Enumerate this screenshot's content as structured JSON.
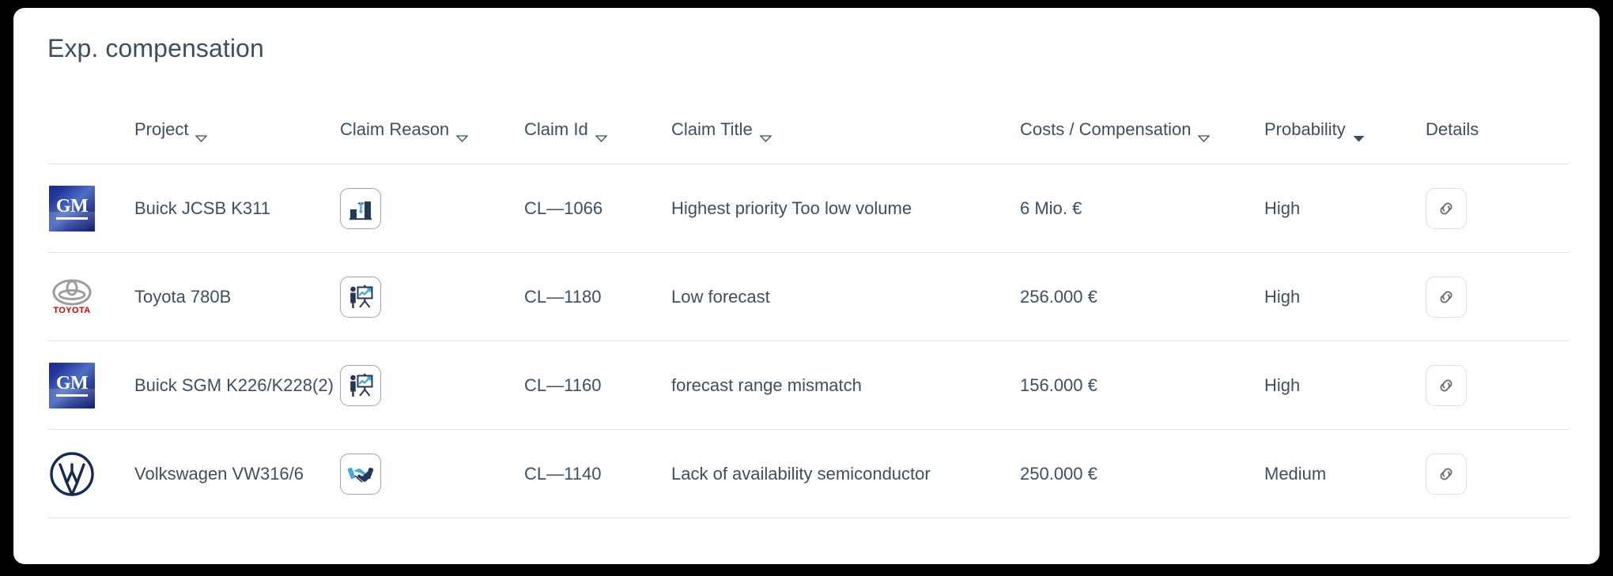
{
  "card": {
    "title": "Exp. compensation"
  },
  "table": {
    "columns": [
      {
        "key": "logo",
        "label": "",
        "sort": "none",
        "icon": ""
      },
      {
        "key": "project",
        "label": "Project",
        "sort": "hollow",
        "icon": "sort-triangle-icon"
      },
      {
        "key": "reason",
        "label": "Claim Reason",
        "sort": "hollow",
        "icon": "sort-triangle-icon"
      },
      {
        "key": "id",
        "label": "Claim Id",
        "sort": "hollow",
        "icon": "sort-triangle-icon"
      },
      {
        "key": "title",
        "label": "Claim Title",
        "sort": "hollow",
        "icon": "sort-triangle-icon"
      },
      {
        "key": "costs",
        "label": "Costs / Compensation",
        "sort": "hollow",
        "icon": "sort-triangle-icon"
      },
      {
        "key": "prob",
        "label": "Probability",
        "sort": "filled",
        "icon": "sort-triangle-filled-icon"
      },
      {
        "key": "details",
        "label": "Details",
        "sort": "none",
        "icon": ""
      }
    ],
    "rows": [
      {
        "brand": "GM",
        "brand_logo": "gm-logo",
        "brand_text": "GM",
        "project": "Buick JCSB K311",
        "reason_icon": "low-volume-bar-chart-icon",
        "claim_id": "CL—1066",
        "claim_title": "Highest priority Too low volume",
        "costs": "6 Mio. €",
        "probability": "High",
        "details_icon": "link-icon"
      },
      {
        "brand": "Toyota",
        "brand_logo": "toyota-logo",
        "brand_text": "TOYOTA",
        "project": "Toyota 780B",
        "reason_icon": "forecast-presentation-icon",
        "claim_id": "CL—1180",
        "claim_title": "Low forecast",
        "costs": "256.000 €",
        "probability": "High",
        "details_icon": "link-icon"
      },
      {
        "brand": "GM",
        "brand_logo": "gm-logo",
        "brand_text": "GM",
        "project": "Buick SGM K226/K228(2)",
        "reason_icon": "forecast-presentation-icon",
        "claim_id": "CL—1160",
        "claim_title": "forecast range mismatch",
        "costs": "156.000 €",
        "probability": "High",
        "details_icon": "link-icon"
      },
      {
        "brand": "Volkswagen",
        "brand_logo": "vw-logo",
        "brand_text": "VW",
        "project": "Volkswagen VW316/6",
        "reason_icon": "handshake-icon",
        "claim_id": "CL—1140",
        "claim_title": "Lack of availability semiconductor",
        "costs": "250.000 €",
        "probability": "Medium",
        "details_icon": "link-icon"
      }
    ]
  },
  "colors": {
    "text": "#3d4f5f",
    "divider": "#dfe3e6",
    "card_background": "#ffffff",
    "page_background": "#000000",
    "accent_blue": "#4aa8d8",
    "icon_navy": "#253858",
    "gm_blue": "#23379e",
    "toyota_red": "#cc0000",
    "details_border": "#e0e0e0"
  }
}
